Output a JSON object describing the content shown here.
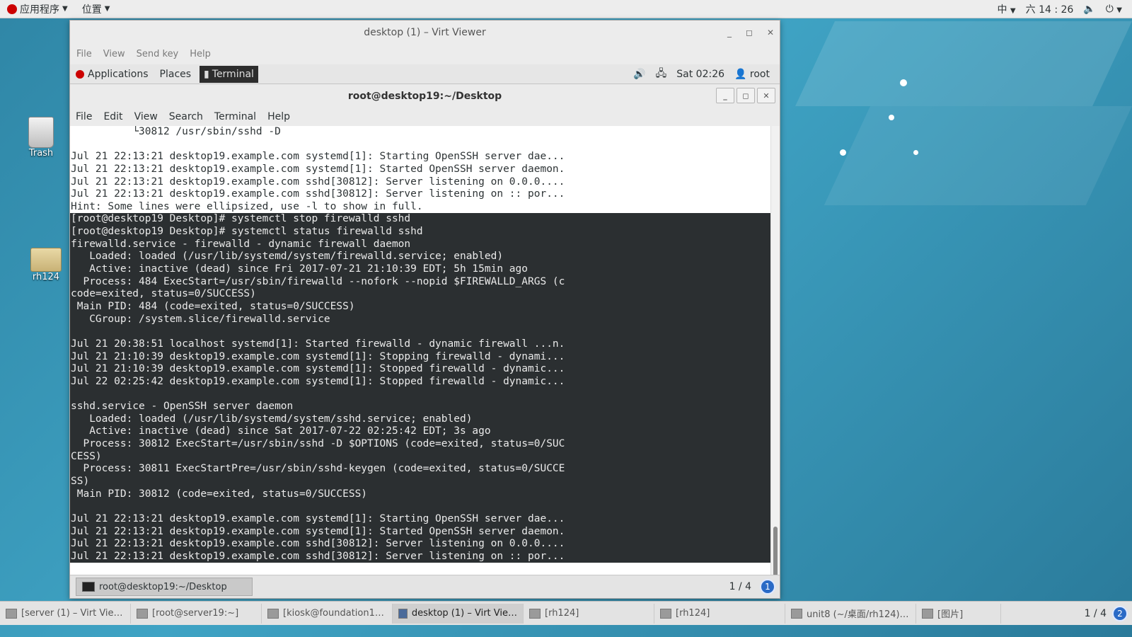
{
  "host": {
    "apps_label": "应用程序",
    "places_label": "位置",
    "input_method": "中",
    "clock": "六 14 : 26"
  },
  "desktop": {
    "trash_label": "Trash",
    "folder_label": "rh124"
  },
  "virt_viewer": {
    "title": "desktop (1) – Virt Viewer",
    "menu": [
      "File",
      "View",
      "Send key",
      "Help"
    ]
  },
  "guest": {
    "applications": "Applications",
    "places": "Places",
    "terminal_tab": "Terminal",
    "clock": "Sat 02:26",
    "user": "root"
  },
  "terminal": {
    "title": "root@desktop19:~/Desktop",
    "menu": [
      "File",
      "Edit",
      "View",
      "Search",
      "Terminal",
      "Help"
    ],
    "lines": [
      {
        "text": "          └30812 /usr/sbin/sshd -D",
        "sel": false
      },
      {
        "text": "",
        "sel": false
      },
      {
        "text": "Jul 21 22:13:21 desktop19.example.com systemd[1]: Starting OpenSSH server dae...",
        "sel": false
      },
      {
        "text": "Jul 21 22:13:21 desktop19.example.com systemd[1]: Started OpenSSH server daemon.",
        "sel": false
      },
      {
        "text": "Jul 21 22:13:21 desktop19.example.com sshd[30812]: Server listening on 0.0.0....",
        "sel": false
      },
      {
        "text": "Jul 21 22:13:21 desktop19.example.com sshd[30812]: Server listening on :: por...",
        "sel": false
      },
      {
        "text": "Hint: Some lines were ellipsized, use -l to show in full.",
        "sel": false
      },
      {
        "text": "[root@desktop19 Desktop]# systemctl stop firewalld sshd",
        "sel": true
      },
      {
        "text": "[root@desktop19 Desktop]# systemctl status firewalld sshd",
        "sel": true
      },
      {
        "text": "firewalld.service - firewalld - dynamic firewall daemon",
        "sel": true
      },
      {
        "text": "   Loaded: loaded (/usr/lib/systemd/system/firewalld.service; enabled)",
        "sel": true
      },
      {
        "text": "   Active: inactive (dead) since Fri 2017-07-21 21:10:39 EDT; 5h 15min ago",
        "sel": true
      },
      {
        "text": "  Process: 484 ExecStart=/usr/sbin/firewalld --nofork --nopid $FIREWALLD_ARGS (c",
        "sel": true
      },
      {
        "text": "code=exited, status=0/SUCCESS)",
        "sel": true
      },
      {
        "text": " Main PID: 484 (code=exited, status=0/SUCCESS)",
        "sel": true
      },
      {
        "text": "   CGroup: /system.slice/firewalld.service",
        "sel": true
      },
      {
        "text": "",
        "sel": true
      },
      {
        "text": "Jul 21 20:38:51 localhost systemd[1]: Started firewalld - dynamic firewall ...n.",
        "sel": true
      },
      {
        "text": "Jul 21 21:10:39 desktop19.example.com systemd[1]: Stopping firewalld - dynami...",
        "sel": true
      },
      {
        "text": "Jul 21 21:10:39 desktop19.example.com systemd[1]: Stopped firewalld - dynamic...",
        "sel": true
      },
      {
        "text": "Jul 22 02:25:42 desktop19.example.com systemd[1]: Stopped firewalld - dynamic...",
        "sel": true
      },
      {
        "text": "",
        "sel": true
      },
      {
        "text": "sshd.service - OpenSSH server daemon",
        "sel": true
      },
      {
        "text": "   Loaded: loaded (/usr/lib/systemd/system/sshd.service; enabled)",
        "sel": true
      },
      {
        "text": "   Active: inactive (dead) since Sat 2017-07-22 02:25:42 EDT; 3s ago",
        "sel": true
      },
      {
        "text": "  Process: 30812 ExecStart=/usr/sbin/sshd -D $OPTIONS (code=exited, status=0/SUC",
        "sel": true
      },
      {
        "text": "CESS)",
        "sel": true
      },
      {
        "text": "  Process: 30811 ExecStartPre=/usr/sbin/sshd-keygen (code=exited, status=0/SUCCE",
        "sel": true
      },
      {
        "text": "SS)",
        "sel": true
      },
      {
        "text": " Main PID: 30812 (code=exited, status=0/SUCCESS)",
        "sel": true
      },
      {
        "text": "",
        "sel": true
      },
      {
        "text": "Jul 21 22:13:21 desktop19.example.com systemd[1]: Starting OpenSSH server dae...",
        "sel": true
      },
      {
        "text": "Jul 21 22:13:21 desktop19.example.com systemd[1]: Started OpenSSH server daemon.",
        "sel": true
      },
      {
        "text": "Jul 21 22:13:21 desktop19.example.com sshd[30812]: Server listening on 0.0.0....",
        "sel": true
      },
      {
        "text": "Jul 21 22:13:21 desktop19.example.com sshd[30812]: Server listening on :: por...",
        "sel": true
      }
    ]
  },
  "guest_taskbar": {
    "item": "root@desktop19:~/Desktop",
    "pager": "1 / 4",
    "workspace": "1"
  },
  "host_taskbar": {
    "items": [
      {
        "label": "[server (1) – Virt Vie…",
        "active": false
      },
      {
        "label": "[root@server19:~]",
        "active": false
      },
      {
        "label": "[kiosk@foundation1…",
        "active": false
      },
      {
        "label": "desktop (1) – Virt Vie…",
        "active": true
      },
      {
        "label": "[rh124]",
        "active": false
      },
      {
        "label": "[rh124]",
        "active": false
      },
      {
        "label": "unit8 (~/桌面/rh124)…",
        "active": false
      },
      {
        "label": "[图片]",
        "active": false
      }
    ],
    "pager": "1 / 4",
    "workspace": "2"
  }
}
